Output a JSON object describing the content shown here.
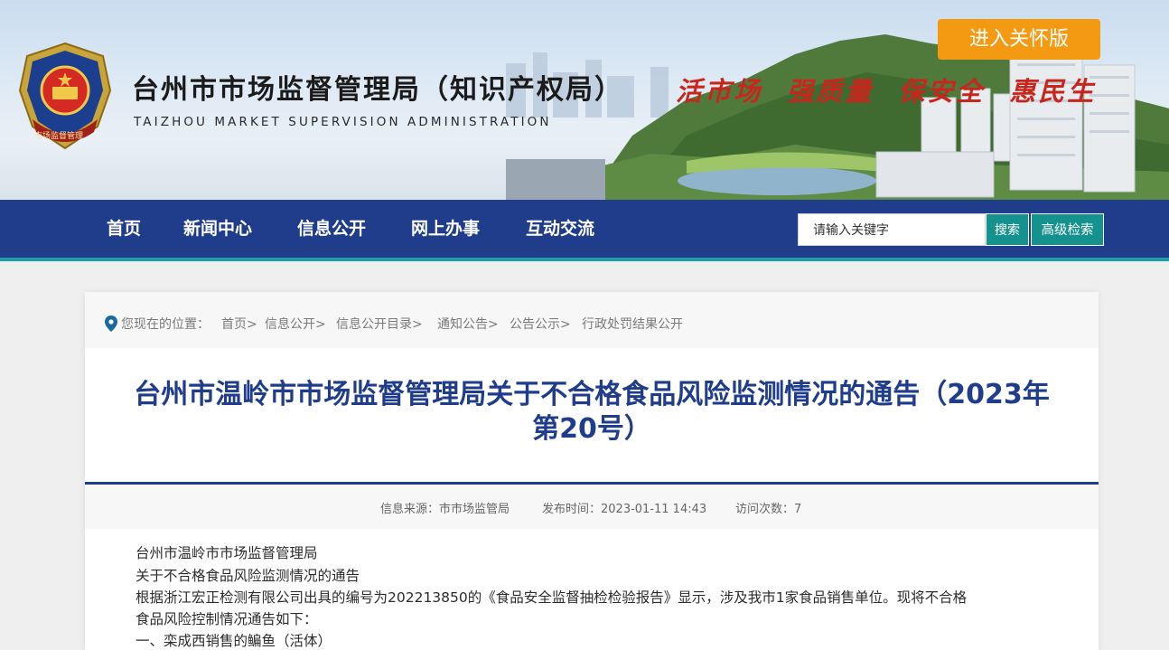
{
  "header": {
    "title": "台州市市场监督管理局（知识产权局）",
    "title_en": "TAIZHOU MARKET SUPERVISION ADMINISTRATION",
    "slogan": "活市场 强质量 保安全 惠民生",
    "care_button": "进入关怀版",
    "emblem_text": "市场监督管理"
  },
  "nav": {
    "items": [
      "首页",
      "新闻中心",
      "信息公开",
      "网上办事",
      "互动交流"
    ],
    "search_placeholder": "请输入关键字",
    "search_button": "搜索",
    "advanced_search_button": "高级检索"
  },
  "breadcrumb": {
    "prefix": "您现在的位置：",
    "items": [
      "首页>",
      "信息公开>",
      "信息公开目录>",
      "通知公告>",
      "公告公示>",
      "行政处罚结果公开"
    ]
  },
  "article": {
    "title_line1": "台州市温岭市市场监督管理局关于不合格食品风险监测情况的通告（2023年",
    "title_line2": "第20号）",
    "source": "信息来源：市市场监管局",
    "publish_time": "发布时间：2023-01-11 14:43",
    "visits": "访问次数：7",
    "body": [
      "台州市温岭市市场监督管理局",
      "关于不合格食品风险监测情况的通告",
      "根据浙江宏正检测有限公司出具的编号为202213850的《食品安全监督抽检检验报告》显示，涉及我市1家食品销售单位。现将不合格",
      "食品风险控制情况通告如下：",
      "一、栾成西销售的鳊鱼（活体）"
    ]
  },
  "colors": {
    "nav_bg": "#1f3d8a",
    "accent_teal": "#15918e",
    "care_orange": "#f49a12",
    "slogan_red": "#c8261d",
    "title_blue": "#1f3d8a"
  }
}
